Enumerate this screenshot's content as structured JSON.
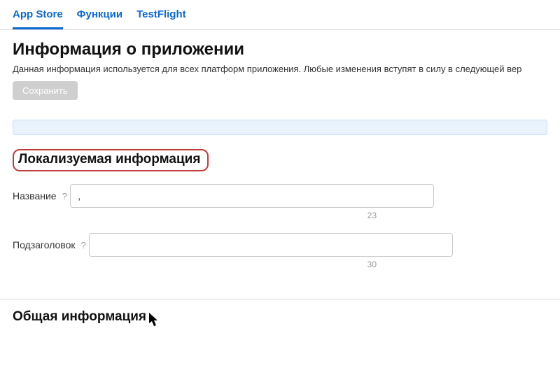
{
  "tabs": [
    {
      "label": "App Store",
      "active": true
    },
    {
      "label": "Функции",
      "active": false
    },
    {
      "label": "TestFlight",
      "active": false
    }
  ],
  "page": {
    "title": "Информация о приложении",
    "description": "Данная информация используется для всех платформ приложения. Любые изменения вступят в силу в следующей вер",
    "save_label": "Сохранить"
  },
  "sections": {
    "localizable": {
      "title": "Локализуемая информация",
      "fields": {
        "name": {
          "label": "Название",
          "help": "?",
          "value": ",",
          "char_count": "23"
        },
        "subtitle": {
          "label": "Подзаголовок",
          "help": "?",
          "value": "",
          "char_count": "30"
        }
      }
    },
    "general": {
      "title": "Общая информация"
    }
  }
}
